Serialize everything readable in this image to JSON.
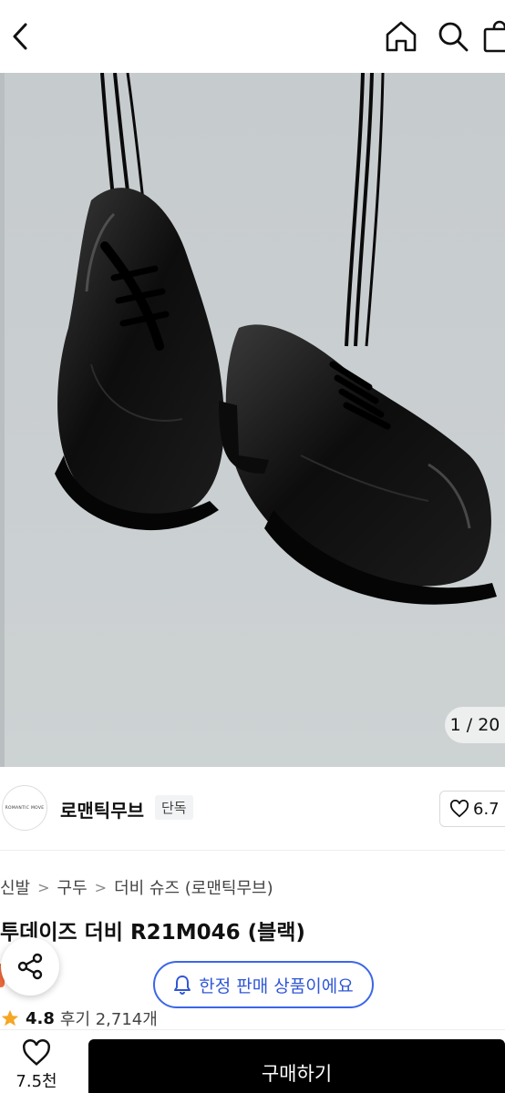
{
  "header": {
    "back_icon": "chevron-left-icon",
    "home_icon": "home-icon",
    "search_icon": "search-icon",
    "bag_icon": "shopping-bag-icon"
  },
  "gallery": {
    "counter": "1 / 20",
    "current": 1,
    "total": 20,
    "background": "#c9ced0"
  },
  "brand": {
    "logo_text": "ROMANTIC MOVE",
    "name": "로맨틱무브",
    "badge": "단독",
    "like_count": "6.7"
  },
  "breadcrumb": [
    "신발",
    "구두",
    "더비 슈즈 (로맨틱무브)"
  ],
  "product": {
    "title": "투데이즈 더비 R21M046 (블랙)"
  },
  "limited": {
    "label": "한정 판매 상품이에요",
    "accent": "#3c66e8"
  },
  "rating": {
    "value": "4.8",
    "reviews": "후기 2,714개"
  },
  "bottom": {
    "wish_count": "7.5천",
    "buy_label": "구매하기"
  }
}
